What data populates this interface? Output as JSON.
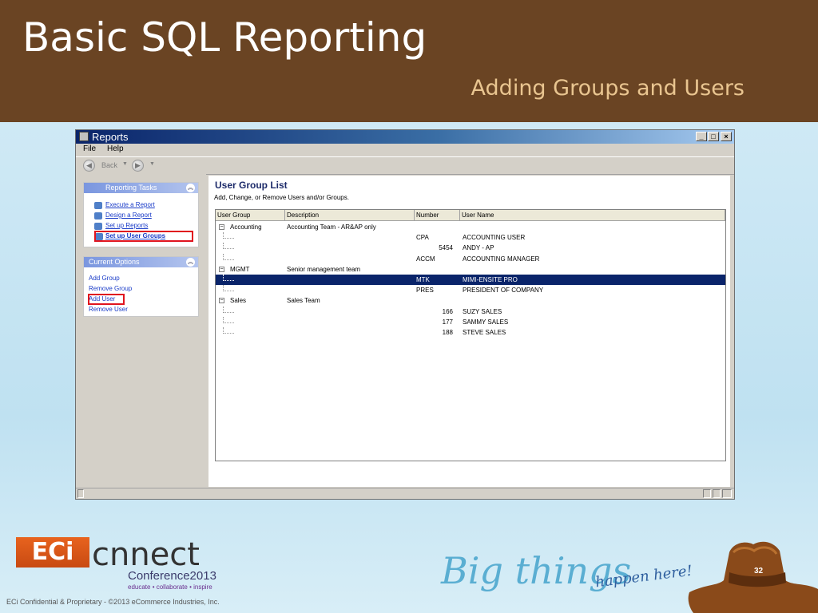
{
  "slide": {
    "title": "Basic SQL Reporting",
    "subtitle": "Adding Groups and Users",
    "footer": "ECi Confidential & Proprietary - ©2013 eCommerce Industries, Inc.",
    "page_number": "32",
    "brand_colors": {
      "banner": "#6a4423",
      "subtitle": "#e9c590",
      "background": "#c6e4f2"
    }
  },
  "logo": {
    "eci": "ECi",
    "connect": "cnnect",
    "conference": "Conference2013",
    "tagline": "educate • collaborate • inspire",
    "big_things": "Big things",
    "happen_here": "happen here!"
  },
  "window": {
    "title": "Reports",
    "menu": [
      "File",
      "Help"
    ],
    "toolbar": {
      "back_label": "Back"
    },
    "controls": [
      "_",
      "□",
      "×"
    ]
  },
  "reporting_tasks": {
    "header": "Reporting Tasks",
    "items": [
      {
        "label": "Execute a Report",
        "icon": "execute-report-icon"
      },
      {
        "label": "Design a Report",
        "icon": "design-report-icon"
      },
      {
        "label": "Set up Reports",
        "icon": "setup-reports-icon"
      },
      {
        "label": "Set up User Groups",
        "icon": "user-groups-icon"
      }
    ]
  },
  "current_options": {
    "header": "Current Options",
    "items": [
      "Add Group",
      "Remove Group",
      "Add User",
      "Remove User"
    ]
  },
  "user_group_list": {
    "title": "User Group List",
    "description": "Add, Change, or Remove Users and/or Groups.",
    "columns": [
      "User Group",
      "Description",
      "Number",
      "User Name"
    ],
    "rows": [
      {
        "group": "Accounting",
        "description": "Accounting Team - AR&AP only",
        "number": "",
        "user": "",
        "type": "group"
      },
      {
        "group": "",
        "description": "",
        "number": "CPA",
        "user": "ACCOUNTING USER",
        "type": "user"
      },
      {
        "group": "",
        "description": "",
        "number": "5454",
        "user": "ANDY - AP",
        "type": "user"
      },
      {
        "group": "",
        "description": "",
        "number": "ACCM",
        "user": "ACCOUNTING MANAGER",
        "type": "user"
      },
      {
        "group": "MGMT",
        "description": "Senior management team",
        "number": "",
        "user": "",
        "type": "group"
      },
      {
        "group": "",
        "description": "",
        "number": "MTK",
        "user": "MIMI-ENSITE PRO",
        "type": "user",
        "selected": true
      },
      {
        "group": "",
        "description": "",
        "number": "PRES",
        "user": "PRESIDENT OF COMPANY",
        "type": "user"
      },
      {
        "group": "Sales",
        "description": "Sales Team",
        "number": "",
        "user": "",
        "type": "group"
      },
      {
        "group": "",
        "description": "",
        "number": "166",
        "user": "SUZY SALES",
        "type": "user"
      },
      {
        "group": "",
        "description": "",
        "number": "177",
        "user": "SAMMY SALES",
        "type": "user"
      },
      {
        "group": "",
        "description": "",
        "number": "188",
        "user": "STEVE SALES",
        "type": "user"
      }
    ]
  }
}
